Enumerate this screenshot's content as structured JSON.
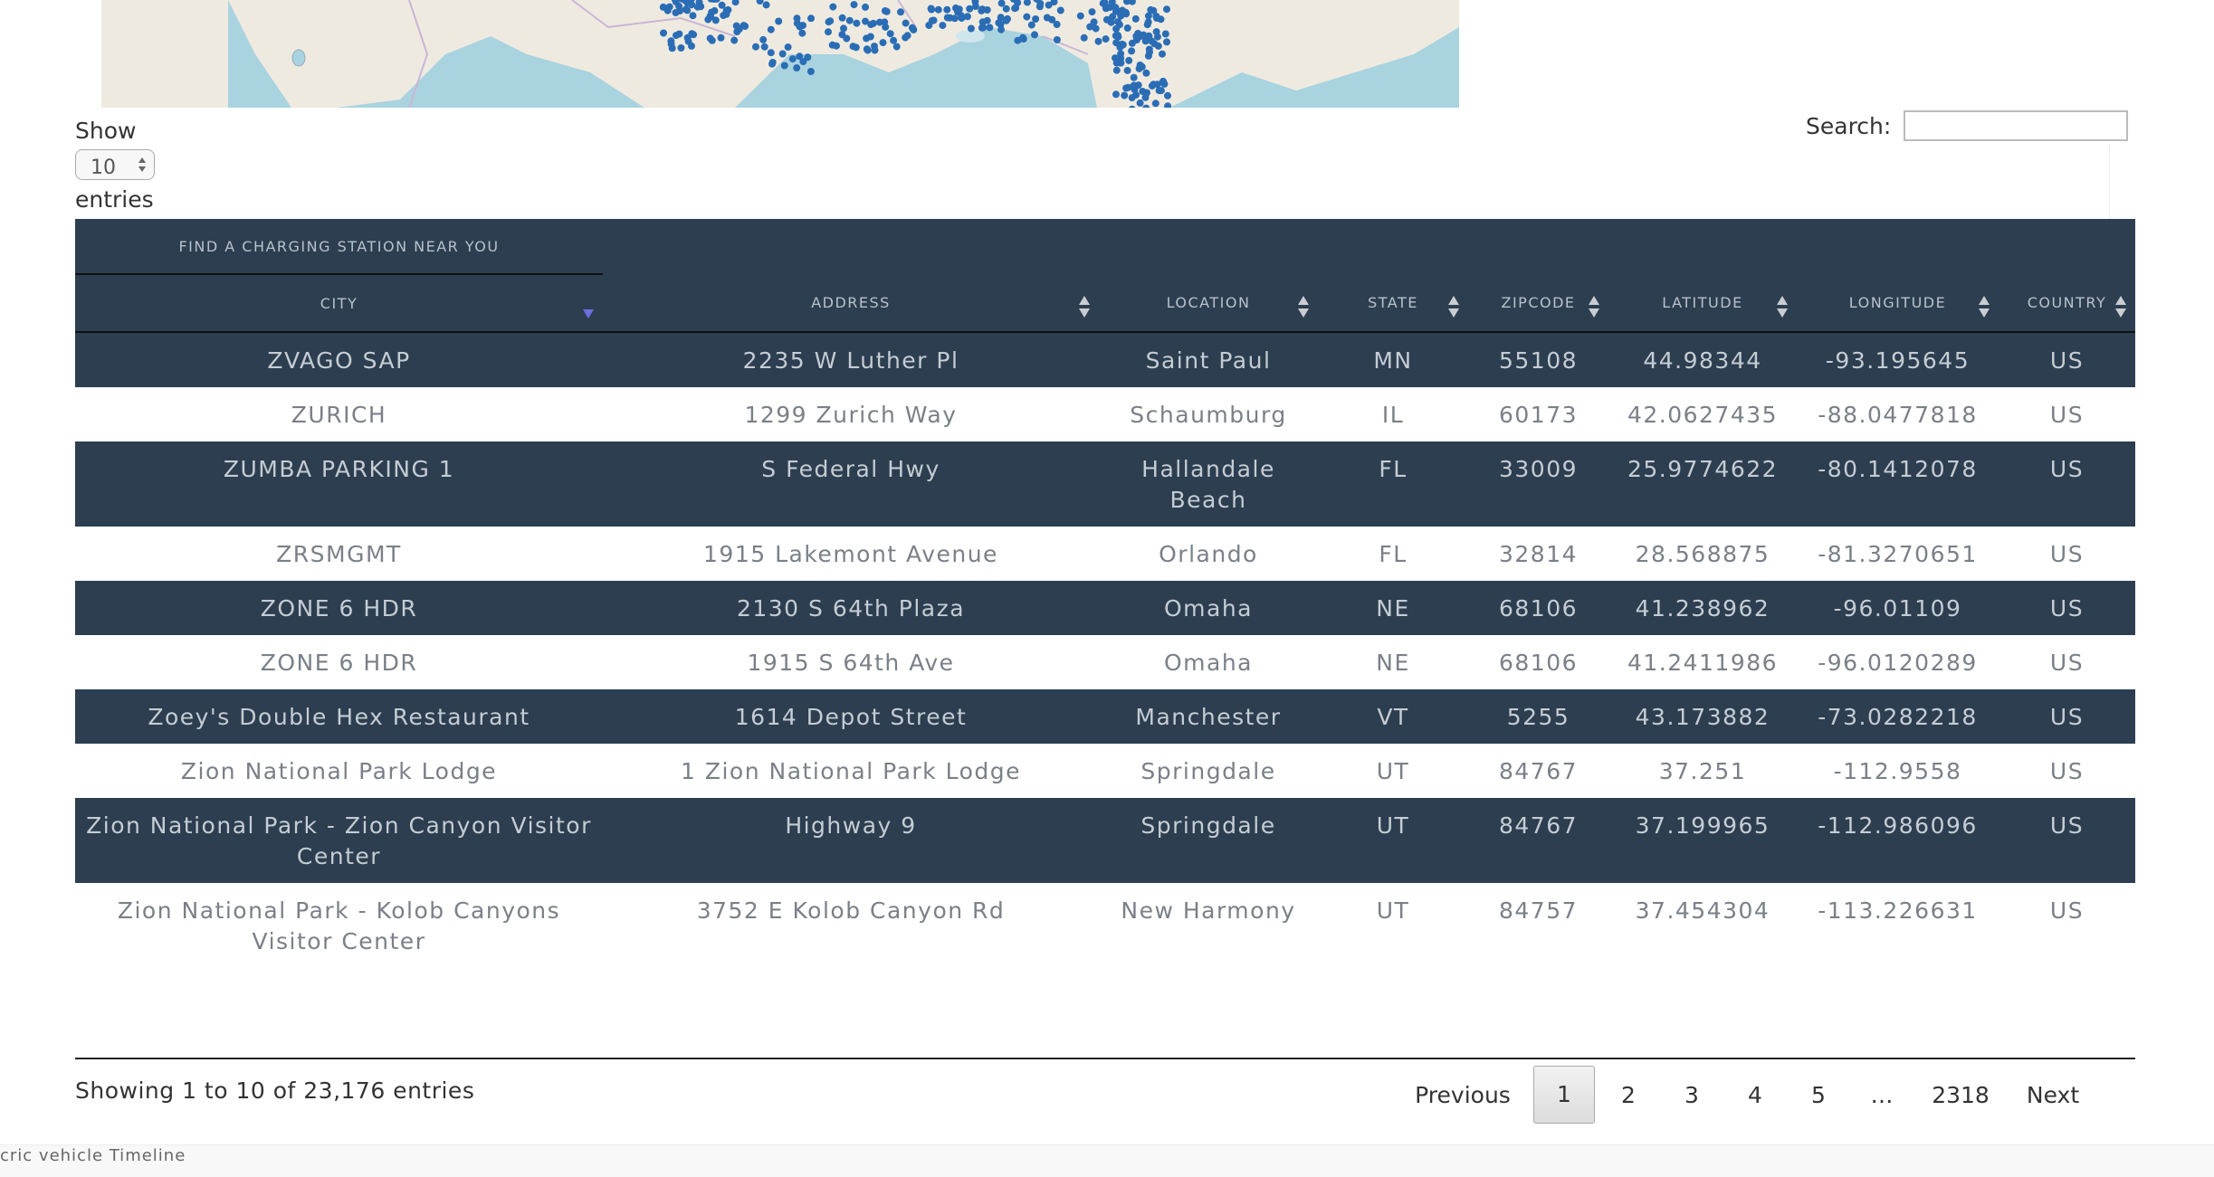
{
  "map": {
    "info_icon": "info-icon"
  },
  "controls": {
    "show_label": "Show",
    "entries_value": "10",
    "entries_label": "entries",
    "search_label": "Search:",
    "search_value": ""
  },
  "table": {
    "super_header": "FIND A CHARGING STATION NEAR YOU",
    "columns": [
      "CITY",
      "ADDRESS",
      "LOCATION",
      "STATE",
      "ZIPCODE",
      "LATITUDE",
      "LONGITUDE",
      "COUNTRY"
    ],
    "rows": [
      [
        "ZVAGO SAP",
        "2235 W Luther Pl",
        "Saint Paul",
        "MN",
        "55108",
        "44.98344",
        "-93.195645",
        "US"
      ],
      [
        "ZURICH",
        "1299 Zurich Way",
        "Schaumburg",
        "IL",
        "60173",
        "42.0627435",
        "-88.0477818",
        "US"
      ],
      [
        "ZUMBA PARKING 1",
        "S Federal Hwy",
        "Hallandale Beach",
        "FL",
        "33009",
        "25.9774622",
        "-80.1412078",
        "US"
      ],
      [
        "ZRSMGMT",
        "1915 Lakemont Avenue",
        "Orlando",
        "FL",
        "32814",
        "28.568875",
        "-81.3270651",
        "US"
      ],
      [
        "ZONE 6 HDR",
        "2130 S 64th Plaza",
        "Omaha",
        "NE",
        "68106",
        "41.238962",
        "-96.01109",
        "US"
      ],
      [
        "ZONE 6 HDR",
        "1915 S 64th Ave",
        "Omaha",
        "NE",
        "68106",
        "41.2411986",
        "-96.0120289",
        "US"
      ],
      [
        "Zoey's Double Hex Restaurant",
        "1614 Depot Street",
        "Manchester",
        "VT",
        "5255",
        "43.173882",
        "-73.0282218",
        "US"
      ],
      [
        "Zion National Park Lodge",
        "1 Zion National Park Lodge",
        "Springdale",
        "UT",
        "84767",
        "37.251",
        "-112.9558",
        "US"
      ],
      [
        "Zion National Park - Zion Canyon Visitor Center",
        "Highway 9",
        "Springdale",
        "UT",
        "84767",
        "37.199965",
        "-112.986096",
        "US"
      ],
      [
        "Zion National Park - Kolob Canyons Visitor Center",
        "3752 E Kolob Canyon Rd",
        "New Harmony",
        "UT",
        "84757",
        "37.454304",
        "-113.226631",
        "US"
      ]
    ]
  },
  "footer_info": "Showing 1 to 10 of 23,176 entries",
  "pagination": {
    "previous": "Previous",
    "pages": [
      "1",
      "2",
      "3",
      "4",
      "5",
      "…",
      "2318"
    ],
    "active": "1",
    "next": "Next"
  },
  "footer_tab": "cric vehicle Timeline",
  "colors": {
    "header_bg": "#2c3e50",
    "accent_sort": "#6f6fe0",
    "map_water": "#a9d3df",
    "marker": "#2a6db5"
  }
}
